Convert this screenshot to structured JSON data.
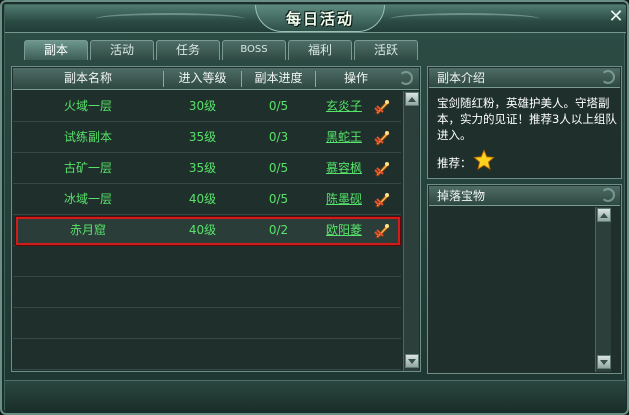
{
  "window": {
    "title": "每日活动",
    "close_glyph": "✕"
  },
  "tabs": [
    {
      "label": "副本",
      "active": true
    },
    {
      "label": "活动",
      "active": false
    },
    {
      "label": "任务",
      "active": false
    },
    {
      "label": "BOSS",
      "active": false
    },
    {
      "label": "福利",
      "active": false
    },
    {
      "label": "活跃",
      "active": false
    }
  ],
  "table": {
    "headers": {
      "name": "副本名称",
      "level": "进入等级",
      "progress": "副本进度",
      "action": "操作"
    },
    "rows": [
      {
        "name": "火域一层",
        "level": "30级",
        "progress": "0/5",
        "action": "玄炎子",
        "selected": false
      },
      {
        "name": "试练副本",
        "level": "35级",
        "progress": "0/3",
        "action": "黑蛇王",
        "selected": false
      },
      {
        "name": "古矿一层",
        "level": "35级",
        "progress": "0/5",
        "action": "慕容枫",
        "selected": false
      },
      {
        "name": "冰域一层",
        "level": "40级",
        "progress": "0/5",
        "action": "陈墨砚",
        "selected": false
      },
      {
        "name": "赤月窟",
        "level": "40级",
        "progress": "0/2",
        "action": "欧阳菱",
        "selected": true
      }
    ],
    "row_icon": "sword-go-icon",
    "empty_rows": 4
  },
  "intro_panel": {
    "title": "副本介绍",
    "description": "宝剑随红粉，英雄护美人。守塔副本，实力的见证！推荐3人以上组队进入。",
    "recommend_label": "推荐：",
    "recommend_stars": 1,
    "star_icon": "star-icon"
  },
  "drops_panel": {
    "title": "掉落宝物"
  },
  "colors": {
    "row_text": "#58e26a",
    "selection_border": "#d11c1c",
    "panel_bg": "#1f302c"
  }
}
